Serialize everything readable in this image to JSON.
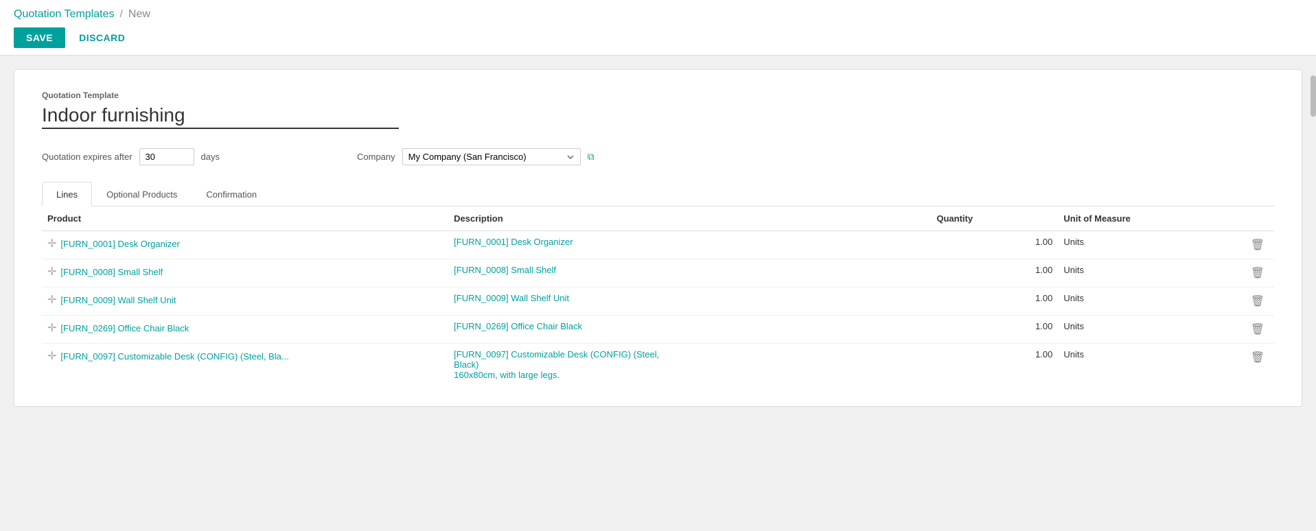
{
  "breadcrumb": {
    "link_label": "Quotation Templates",
    "separator": "/",
    "current": "New"
  },
  "toolbar": {
    "save_label": "SAVE",
    "discard_label": "DISCARD"
  },
  "form": {
    "section_label": "Quotation Template",
    "template_name": "Indoor furnishing",
    "template_name_placeholder": "Indoor furnishing",
    "expires_label": "Quotation expires after",
    "expires_value": "30",
    "expires_unit": "days",
    "company_label": "Company",
    "company_value": "My Company (San Francisco)",
    "company_options": [
      "My Company (San Francisco)"
    ]
  },
  "tabs": [
    {
      "label": "Lines",
      "active": true
    },
    {
      "label": "Optional Products",
      "active": false
    },
    {
      "label": "Confirmation",
      "active": false
    }
  ],
  "table": {
    "columns": [
      {
        "key": "product",
        "label": "Product"
      },
      {
        "key": "description",
        "label": "Description"
      },
      {
        "key": "quantity",
        "label": "Quantity"
      },
      {
        "key": "uom",
        "label": "Unit of Measure"
      }
    ],
    "rows": [
      {
        "product": "[FURN_0001] Desk Organizer",
        "description": "[FURN_0001] Desk Organizer",
        "quantity": "1.00",
        "uom": "Units"
      },
      {
        "product": "[FURN_0008] Small Shelf",
        "description": "[FURN_0008] Small Shelf",
        "quantity": "1.00",
        "uom": "Units"
      },
      {
        "product": "[FURN_0009] Wall Shelf Unit",
        "description": "[FURN_0009] Wall Shelf Unit",
        "quantity": "1.00",
        "uom": "Units"
      },
      {
        "product": "[FURN_0269] Office Chair Black",
        "description": "[FURN_0269] Office Chair Black",
        "quantity": "1.00",
        "uom": "Units"
      },
      {
        "product": "[FURN_0097] Customizable Desk (CONFIG) (Steel, Bla...",
        "description_line1": "[FURN_0097] Customizable Desk (CONFIG) (Steel,",
        "description_line2": "Black)",
        "description_line3": "160x80cm, with large legs.",
        "quantity": "1.00",
        "uom": "Units",
        "multiline": true
      }
    ]
  },
  "icons": {
    "drag": "✛",
    "delete": "🗑",
    "external_link": "⧉",
    "dropdown_arrow": "▾"
  }
}
